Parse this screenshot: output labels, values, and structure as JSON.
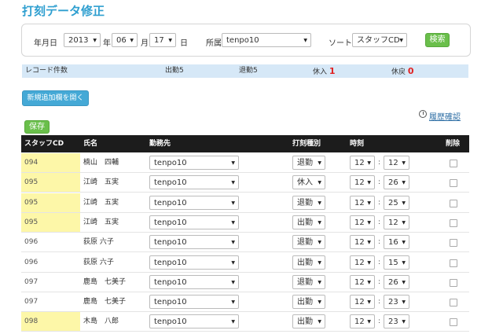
{
  "page_title": "打刻データ修正",
  "filter": {
    "year_label": "年月日",
    "year_value": "2013",
    "year_unit": "年",
    "month_value": "06",
    "month_unit": "月",
    "day_value": "17",
    "day_unit": "日",
    "store_label": "所属",
    "store_value": "tenpo10",
    "sort_label": "ソート",
    "sort_value": "スタッフCD",
    "search_label": "検索"
  },
  "summary": {
    "record_count_label": "レコード件数",
    "clock_in": "出勤5",
    "clock_out": "退勤5",
    "break_in_label": "休入",
    "break_in_value": "1",
    "break_out_label": "休戻",
    "break_out_value": "0"
  },
  "add_new_label": "新規追加欄を開く",
  "save_label": "保存",
  "history_label": "履歴確認",
  "table": {
    "headers": {
      "cd": "スタッフCD",
      "name": "氏名",
      "site": "勤務先",
      "type": "打刻種別",
      "time": "時刻",
      "delete": "削除"
    },
    "rows": [
      {
        "cd": "094",
        "name": "楠山　四輔",
        "site": "tenpo10",
        "type": "退勤",
        "hour": "12",
        "minute": "12"
      },
      {
        "cd": "095",
        "name": "江崎　五実",
        "site": "tenpo10",
        "type": "休入",
        "hour": "12",
        "minute": "26"
      },
      {
        "cd": "095",
        "name": "江崎　五実",
        "site": "tenpo10",
        "type": "退勤",
        "hour": "12",
        "minute": "25"
      },
      {
        "cd": "095",
        "name": "江崎　五実",
        "site": "tenpo10",
        "type": "出勤",
        "hour": "12",
        "minute": "12"
      },
      {
        "cd": "096",
        "name": "荻原 六子",
        "site": "tenpo10",
        "type": "退勤",
        "hour": "12",
        "minute": "16"
      },
      {
        "cd": "096",
        "name": "荻原 六子",
        "site": "tenpo10",
        "type": "出勤",
        "hour": "12",
        "minute": "15"
      },
      {
        "cd": "097",
        "name": "鹿島　七美子",
        "site": "tenpo10",
        "type": "退勤",
        "hour": "12",
        "minute": "26"
      },
      {
        "cd": "097",
        "name": "鹿島　七美子",
        "site": "tenpo10",
        "type": "出勤",
        "hour": "12",
        "minute": "23"
      },
      {
        "cd": "098",
        "name": "木島　八郎",
        "site": "tenpo10",
        "type": "出勤",
        "hour": "12",
        "minute": "23"
      }
    ]
  },
  "colors": {
    "title": "#2f9fd0",
    "accent_green": "#6abf4b",
    "accent_blue": "#45a9d6",
    "header_bg": "#1c1c1c",
    "highlight": "#fdf7a8",
    "summary_bg": "#d6e8f7",
    "count_red": "#e02020"
  },
  "icons": {
    "history": "clock-icon",
    "dropdown": "caret-down-icon"
  }
}
